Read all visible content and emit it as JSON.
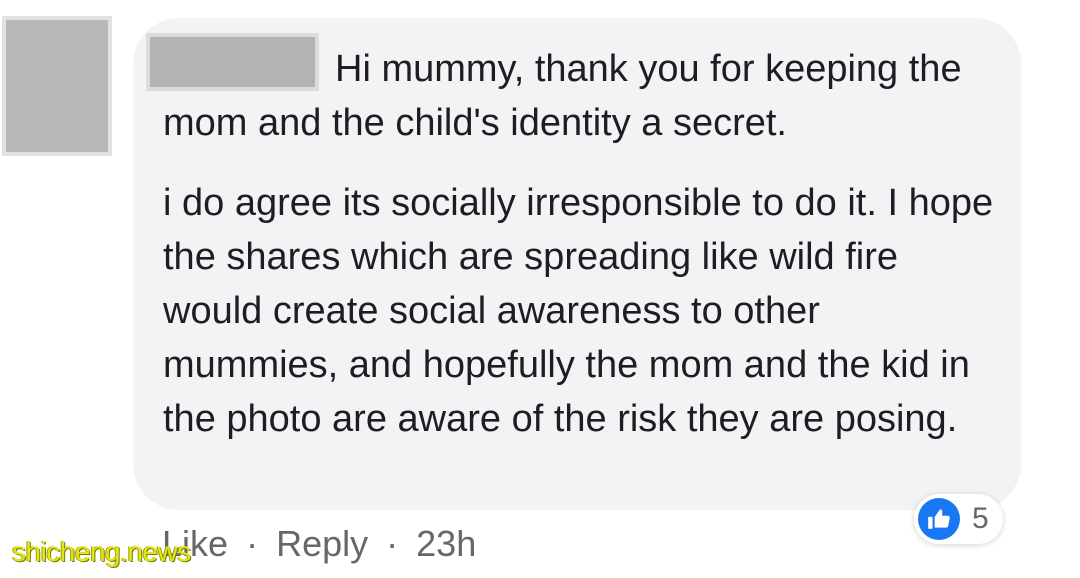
{
  "comment": {
    "author_name": "",
    "paragraph_1": "Hi mummy, thank you for keeping the mom and the child's identity a secret.",
    "paragraph_2": "i do agree its socially irresponsible to do it. I hope the shares which are spreading like wild fire would create social awareness to other mummies, and hopefully the mom and the kid in the photo are aware of the risk they are posing."
  },
  "reactions": {
    "icon": "like-thumb-icon",
    "count": "5",
    "color": "#1877f2"
  },
  "actions": {
    "like_label": "Like",
    "separator": "·",
    "reply_label": "Reply",
    "timestamp": "23h"
  },
  "watermark": {
    "text": "shicheng.news"
  },
  "colors": {
    "bubble_bg": "#f2f3f5",
    "text": "#1c1e21",
    "meta_text": "#65676b",
    "redaction": "#b3b3b3"
  }
}
